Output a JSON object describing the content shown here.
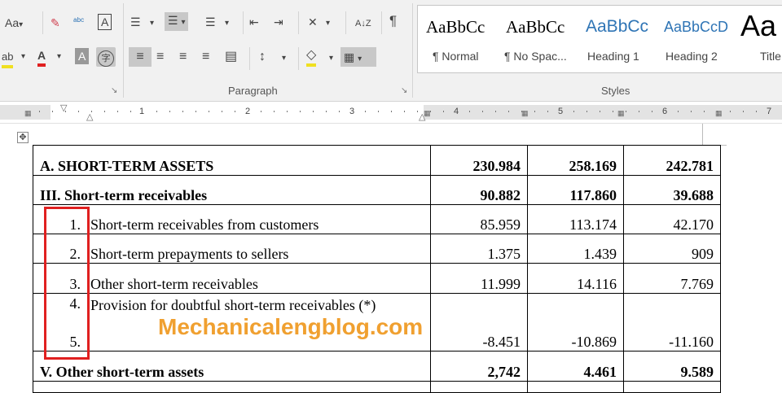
{
  "ribbon": {
    "font_group": {
      "change_case": "Aa",
      "change_case_arrow": "▾",
      "clear_formatting": "✎",
      "phonetic_guide": "ᵃᵇᶜ",
      "character_border": "A",
      "highlight": "ab",
      "font_color": "A",
      "character_shading": "A",
      "enclose_characters": "字"
    },
    "paragraph_group": {
      "label": "Paragraph",
      "bullets": "☰",
      "numbering": "☰",
      "multilevel": "☰",
      "decrease_indent": "⇤",
      "increase_indent": "⇥",
      "asian_layout": "✕",
      "sort": "A↓Z",
      "show_marks": "¶",
      "align_left": "≡",
      "center": "≡",
      "align_right": "≡",
      "justify": "≡",
      "distributed": "▤",
      "line_spacing": "↕",
      "shading": "◇",
      "borders": "▦",
      "launcher": "↘"
    },
    "styles_group": {
      "label": "Styles",
      "items": [
        {
          "sample": "AaBbCc",
          "name": "¶ Normal",
          "color": "#000000"
        },
        {
          "sample": "AaBbCc",
          "name": "¶ No Spac...",
          "color": "#000000"
        },
        {
          "sample": "AaBbCc",
          "name": "Heading 1",
          "color": "#2e74b5"
        },
        {
          "sample": "AaBbCcD",
          "name": "Heading 2",
          "color": "#2e74b5"
        },
        {
          "sample": "Aa",
          "name": "Title",
          "color": "#000000"
        }
      ]
    },
    "launcher": "↘"
  },
  "ruler": {
    "numbers": [
      "1",
      "2",
      "3",
      "4",
      "5",
      "6",
      "7"
    ]
  },
  "table": {
    "rows": [
      {
        "index": "",
        "label": "A. SHORT-TERM ASSETS",
        "v1": "230.984",
        "v2": "258.169",
        "v3": "242.781",
        "bold": true
      },
      {
        "index": "",
        "label": "III. Short-term receivables",
        "v1": "90.882",
        "v2": "117.860",
        "v3": "39.688",
        "bold": true
      },
      {
        "index": "1.",
        "label": "Short-term receivables from customers",
        "v1": "85.959",
        "v2": "113.174",
        "v3": "42.170",
        "bold": false
      },
      {
        "index": "2.",
        "label": "Short-term prepayments to sellers",
        "v1": "1.375",
        "v2": "1.439",
        "v3": "909",
        "bold": false
      },
      {
        "index": "3.",
        "label": "Other short-term receivables",
        "v1": "11.999",
        "v2": "14.116",
        "v3": "7.769",
        "bold": false
      },
      {
        "index": "4.",
        "label": "Provision for doubtful short-term receivables (*)",
        "index2": "5.",
        "v1": "-8.451",
        "v2": "-10.869",
        "v3": "-11.160",
        "bold": false
      },
      {
        "index": "",
        "label": "V. Other short-term assets",
        "v1": "2,742",
        "v2": "4.461",
        "v3": "9.589",
        "bold": true
      }
    ]
  },
  "watermark": "Mechanicalengblog.com",
  "move_handle": "✥",
  "colors": {
    "ribbon_bg": "#f1f1f1",
    "highlight_selected": "#c8c8c8",
    "heading_blue": "#2e74b5",
    "annotation_red": "#e02020",
    "watermark_orange": "#f0a030"
  }
}
